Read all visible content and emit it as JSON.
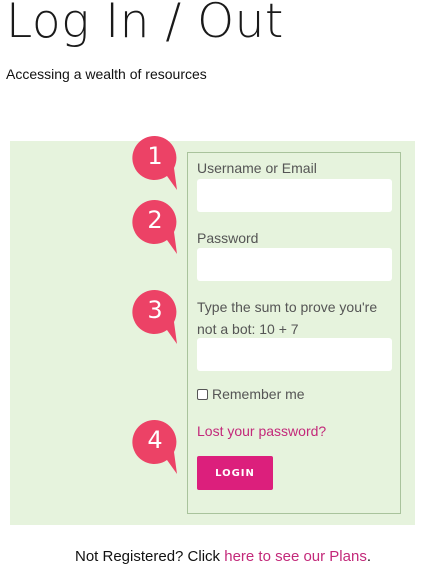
{
  "header": {
    "title": "Log In / Out",
    "subtitle": "Accessing a wealth of resources"
  },
  "form": {
    "username_label": "Username or Email",
    "username_value": "",
    "password_label": "Password",
    "password_value": "",
    "captcha_label_line1": "Type the sum to prove you're",
    "captcha_label_line2": "not a bot: 10 + 7",
    "captcha_value": "",
    "remember_label": "Remember me",
    "remember_checked": false,
    "lost_password_link": "Lost your password?",
    "login_button": "LOGIN"
  },
  "callouts": [
    "1",
    "2",
    "3",
    "4"
  ],
  "footer": {
    "prefix": "Not Registered? Click ",
    "link": "here to see our Plans",
    "suffix": "."
  },
  "colors": {
    "accent": "#dc1f7c",
    "link": "#c3297a",
    "callout": "#ec4266",
    "panel_bg": "#e6f3dd"
  }
}
